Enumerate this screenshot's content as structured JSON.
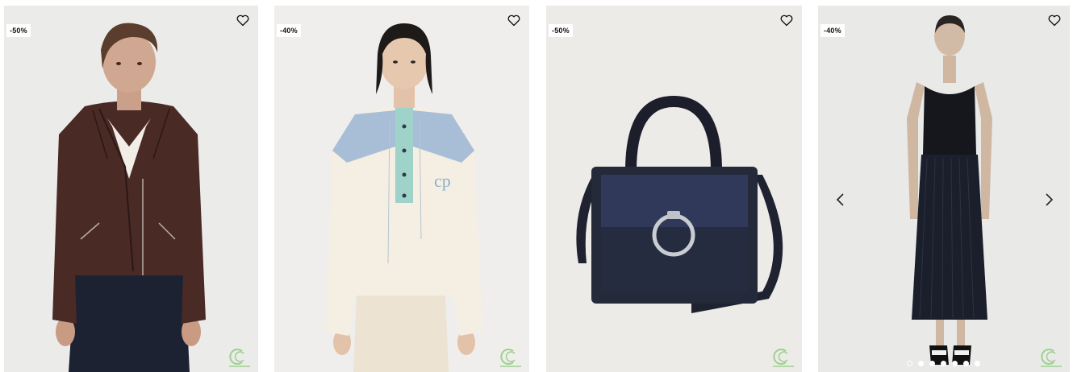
{
  "products": [
    {
      "discount": "-50%",
      "item": "leather biker jacket",
      "bg": "#ebebea"
    },
    {
      "discount": "-40%",
      "item": "color-block sweatshirt",
      "bg": "#efeeec"
    },
    {
      "discount": "-50%",
      "item": "navy handbag",
      "bg": "#edebe8"
    },
    {
      "discount": "-40%",
      "item": "black pleated dress",
      "bg": "#e9e9e8"
    }
  ],
  "carousel": {
    "dot_count": 7,
    "active_index": 1
  },
  "icons": {
    "favorite": "heart-icon",
    "prev": "chevron-left-icon",
    "next": "chevron-right-icon",
    "brand": "brand-logo-icon"
  },
  "colors": {
    "badge_bg": "#ffffff",
    "logo_green": "#9bd28d"
  }
}
